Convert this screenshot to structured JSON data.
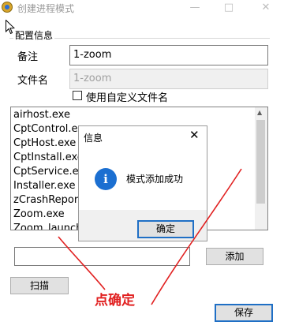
{
  "window": {
    "title": "创建进程模式",
    "minimize_glyph": "—",
    "maximize_glyph": "□",
    "close_glyph": "✕"
  },
  "config": {
    "group_title": "配置信息",
    "note_label": "备注",
    "note_value": "1-zoom",
    "filename_label": "文件名",
    "filename_value": "1-zoom",
    "custom_filename_label": "使用自定义文件名",
    "custom_filename_checked": false
  },
  "process_list": {
    "items": [
      "airhost.exe",
      "CptControl.exe",
      "CptHost.exe",
      "CptInstall.exe",
      "CptService.exe",
      "Installer.exe",
      "zCrashReport.exe",
      "Zoom.exe",
      "Zoom_launcher.exe"
    ]
  },
  "add_row": {
    "input_value": "",
    "add_label": "添加"
  },
  "scan_label": "扫描",
  "save_label": "保存",
  "dialog": {
    "title": "信息",
    "message": "模式添加成功",
    "ok_label": "确定",
    "close_glyph": "✕",
    "info_glyph": "i"
  },
  "annotation": {
    "text": "点确定",
    "color": "#e12020"
  },
  "colors": {
    "accent": "#1f6fc5",
    "info_icon": "#1b6fd1",
    "disabled_text": "#a0a0a0"
  }
}
